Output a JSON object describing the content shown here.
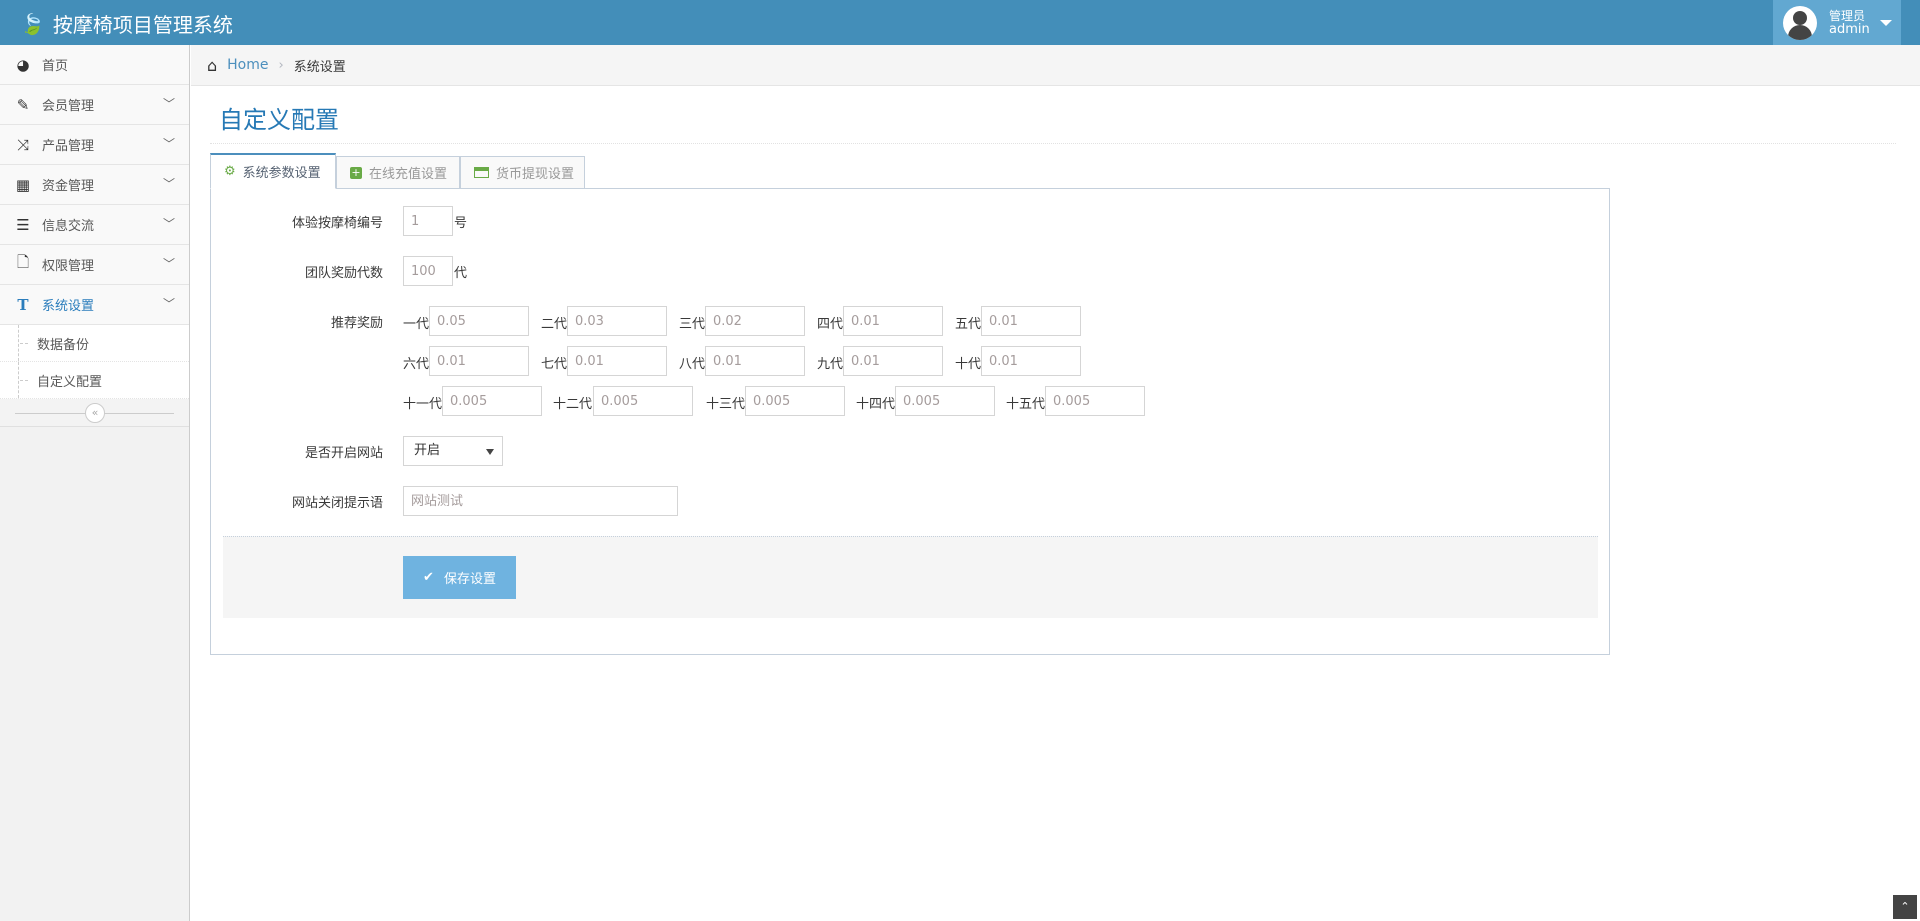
{
  "header": {
    "app_title": "按摩椅项目管理系统",
    "user_role": "管理员",
    "username": "admin",
    "brand_color": "#438eb9"
  },
  "sidebar": {
    "items": [
      {
        "label": "首页",
        "icon": "dashboard-icon"
      },
      {
        "label": "会员管理",
        "icon": "edit-icon"
      },
      {
        "label": "产品管理",
        "icon": "random-icon"
      },
      {
        "label": "资金管理",
        "icon": "calendar-icon"
      },
      {
        "label": "信息交流",
        "icon": "list-icon"
      },
      {
        "label": "权限管理",
        "icon": "file-icon"
      },
      {
        "label": "系统设置",
        "icon": "text-icon"
      }
    ],
    "subitems": [
      {
        "label": "数据备份"
      },
      {
        "label": "自定义配置"
      }
    ]
  },
  "breadcrumb": {
    "home": "Home",
    "current": "系统设置"
  },
  "page_title": "自定义配置",
  "tabs": [
    {
      "label": "系统参数设置"
    },
    {
      "label": "在线充值设置"
    },
    {
      "label": "货币提现设置"
    }
  ],
  "form": {
    "chair_no": {
      "label": "体验按摩椅编号",
      "value": "1",
      "suffix": "号"
    },
    "team_levels": {
      "label": "团队奖励代数",
      "value": "100",
      "suffix": "代"
    },
    "referral": {
      "label": "推荐奖励",
      "levels": [
        {
          "label": "一代",
          "value": "0.05"
        },
        {
          "label": "二代",
          "value": "0.03"
        },
        {
          "label": "三代",
          "value": "0.02"
        },
        {
          "label": "四代",
          "value": "0.01"
        },
        {
          "label": "五代",
          "value": "0.01"
        },
        {
          "label": "六代",
          "value": "0.01"
        },
        {
          "label": "七代",
          "value": "0.01"
        },
        {
          "label": "八代",
          "value": "0.01"
        },
        {
          "label": "九代",
          "value": "0.01"
        },
        {
          "label": "十代",
          "value": "0.01"
        },
        {
          "label": "十一代",
          "value": "0.005"
        },
        {
          "label": "十二代",
          "value": "0.005"
        },
        {
          "label": "十三代",
          "value": "0.005"
        },
        {
          "label": "十四代",
          "value": "0.005"
        },
        {
          "label": "十五代",
          "value": "0.005"
        }
      ]
    },
    "site_open": {
      "label": "是否开启网站",
      "value": "开启"
    },
    "close_msg": {
      "label": "网站关闭提示语",
      "value": "网站测试"
    },
    "save_label": "保存设置"
  }
}
